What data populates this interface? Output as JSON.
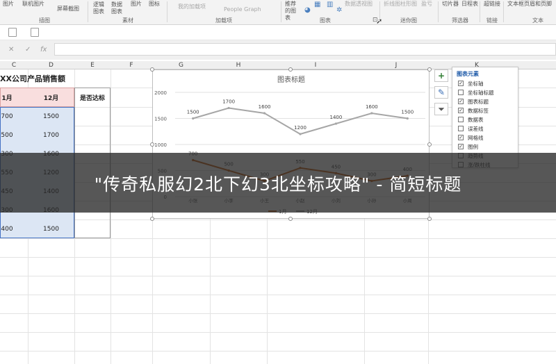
{
  "ribbon": {
    "items": [
      "图片",
      "联机图片",
      "屏幕截图",
      "逻辑图表",
      "数据图表",
      "图片",
      "图标",
      "我的加载项",
      "People Graph",
      "推荐的图表",
      "数据透视图",
      "折线图",
      "柱形图",
      "盈亏",
      "切片器",
      "日程表",
      "超链接",
      "文本框",
      "页眉和页脚"
    ],
    "groups": [
      "插图",
      "素材",
      "加载项",
      "图表",
      "迷你图",
      "筛选器",
      "链接",
      "文本"
    ]
  },
  "formula_bar": {
    "cancel": "✕",
    "confirm": "✓",
    "fx": "fx",
    "value": ""
  },
  "columns": [
    "C",
    "D",
    "E",
    "F",
    "G",
    "H",
    "I",
    "J",
    "K"
  ],
  "sheet": {
    "title": "XX公司产品销售额",
    "headers": [
      "1月",
      "12月",
      "是否达标"
    ],
    "rows": [
      [
        "700",
        "1500",
        ""
      ],
      [
        "500",
        "1700",
        ""
      ],
      [
        "300",
        "1600",
        ""
      ],
      [
        "550",
        "1200",
        ""
      ],
      [
        "450",
        "1400",
        ""
      ],
      [
        "300",
        "1600",
        ""
      ],
      [
        "400",
        "1500",
        ""
      ]
    ]
  },
  "chart_data": {
    "type": "line",
    "title": "图表标题",
    "categories": [
      "小张",
      "小李",
      "小王",
      "小赵",
      "小刘",
      "小孙",
      "小周"
    ],
    "series": [
      {
        "name": "12月",
        "values": [
          1500,
          1700,
          1600,
          1200,
          1400,
          1600,
          1500
        ],
        "color": "#a6a6a6"
      },
      {
        "name": "1月",
        "values": [
          700,
          500,
          300,
          550,
          450,
          300,
          400
        ],
        "color": "#c55a11"
      }
    ],
    "y_ticks": [
      0,
      500,
      1000,
      1500,
      2000
    ],
    "ylim": [
      0,
      2000
    ],
    "legend": "bottom",
    "grid": true
  },
  "chart_elements": {
    "header": "图表元素",
    "items": [
      {
        "label": "坐标轴",
        "checked": true
      },
      {
        "label": "坐标轴标题",
        "checked": false
      },
      {
        "label": "图表标题",
        "checked": true
      },
      {
        "label": "数据标签",
        "checked": true
      },
      {
        "label": "数据表",
        "checked": false
      },
      {
        "label": "误差线",
        "checked": false
      },
      {
        "label": "网格线",
        "checked": true
      },
      {
        "label": "图例",
        "checked": true
      },
      {
        "label": "趋势线",
        "checked": false
      },
      {
        "label": "涨/跌柱线",
        "checked": false
      }
    ]
  },
  "side_buttons": [
    "plus-icon",
    "brush-icon",
    "filter-icon"
  ],
  "overlay": {
    "text": "\"传奇私服幻2北下幻3北坐标攻略\" - 简短标题"
  }
}
